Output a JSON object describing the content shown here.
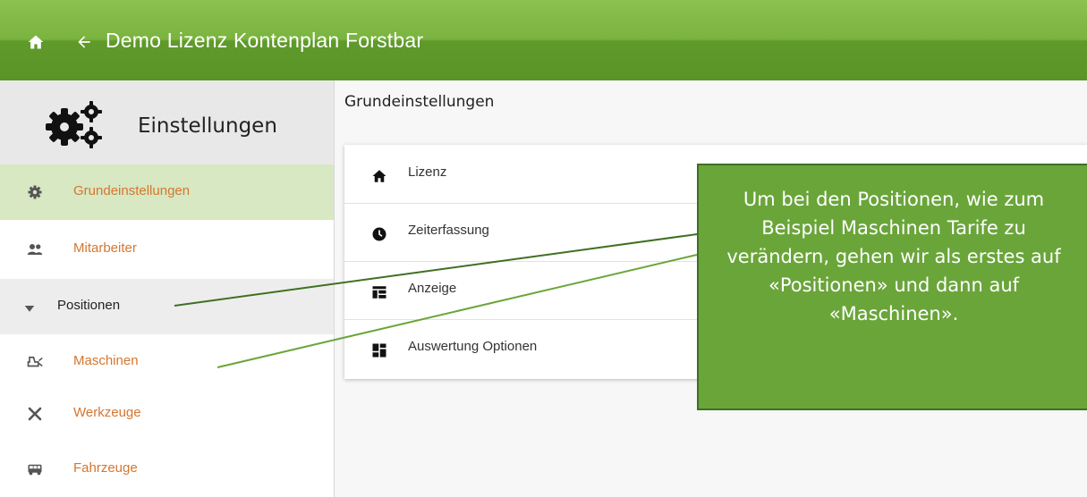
{
  "topbar": {
    "title": "Demo Lizenz Kontenplan Forstbar",
    "home_icon": "home-icon",
    "back_icon": "arrow-left-icon",
    "color": "#7ab33f"
  },
  "sidebar": {
    "header": "Einstellungen",
    "items": [
      {
        "label": "Grundeinstellungen",
        "icon": "gear-icon",
        "active": true
      },
      {
        "label": "Mitarbeiter",
        "icon": "people-icon"
      },
      {
        "label": "Positionen",
        "icon": "caret-down-icon",
        "group": true
      },
      {
        "label": "Maschinen",
        "icon": "machine-icon"
      },
      {
        "label": "Werkzeuge",
        "icon": "tools-icon"
      },
      {
        "label": "Fahrzeuge",
        "icon": "bus-icon"
      }
    ],
    "accent_color": "#d5762e"
  },
  "main": {
    "title": "Grundeinstellungen",
    "rows": [
      {
        "label": "Lizenz",
        "icon": "home-icon"
      },
      {
        "label": "Zeiterfassung",
        "icon": "clock-icon"
      },
      {
        "label": "Anzeige",
        "icon": "layout-icon"
      },
      {
        "label": "Auswertung Optionen",
        "icon": "dashboard-icon"
      }
    ]
  },
  "callout": {
    "lines": [
      "Um bei den Positionen, wie zum",
      "Beispiel Maschinen Tarife zu",
      "verändern, gehen wir als erstes auf",
      "«Positionen» und dann auf",
      "«Maschinen»."
    ],
    "color": "#6aa53a"
  }
}
